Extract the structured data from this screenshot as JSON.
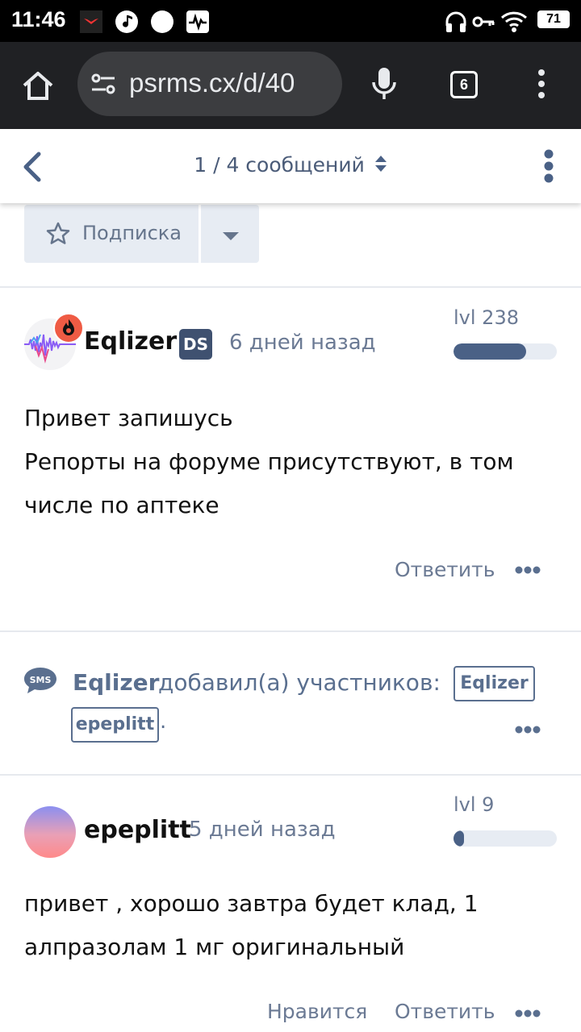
{
  "status_bar": {
    "time": "11:46",
    "battery": "71",
    "icons": [
      "app-notification-icon",
      "music-icon",
      "circle-icon",
      "activity-icon",
      "headphones-icon",
      "key-icon",
      "wifi-icon"
    ]
  },
  "browser": {
    "url": "psrms.cx/d/40",
    "tab_count": "6",
    "icons": [
      "home-icon",
      "site-settings-icon",
      "mic-icon",
      "tabs-icon",
      "more-vert-icon"
    ]
  },
  "discussion_header": {
    "position": "1 / 4 сообщений",
    "icons": [
      "back-chevron-icon",
      "sort-arrows-icon",
      "more-vert-icon"
    ]
  },
  "subscribe": {
    "label": "Подписка",
    "icons": [
      "star-outline-icon",
      "caret-down-icon"
    ]
  },
  "posts": [
    {
      "username": "Eqlizer",
      "badge": "DS",
      "time": "6 дней назад",
      "level": "lvl 238",
      "level_progress": 0.7,
      "lines": [
        "Привет запишусь",
        "Репорты на форуме присутствуют, в том",
        "числе по аптеке"
      ],
      "reply": "Ответить"
    },
    {
      "username": "epeplitt",
      "time": "5 дней назад",
      "level": "lvl 9",
      "level_progress": 0.1,
      "lines": [
        "привет , хорошо завтра будет клад, 1",
        "алпразолам 1 мг оригинальный"
      ],
      "like": "Нравится",
      "reply": "Ответить"
    }
  ],
  "event": {
    "user": "Eqlizer",
    "text": "добавил(а) участников:",
    "tags": [
      "Eqlizer",
      "epeplitt"
    ],
    "period": "."
  },
  "colors": {
    "accent": "#4a6186",
    "muted_text": "#6b7a94",
    "flame_badge": "#ef5b44"
  }
}
